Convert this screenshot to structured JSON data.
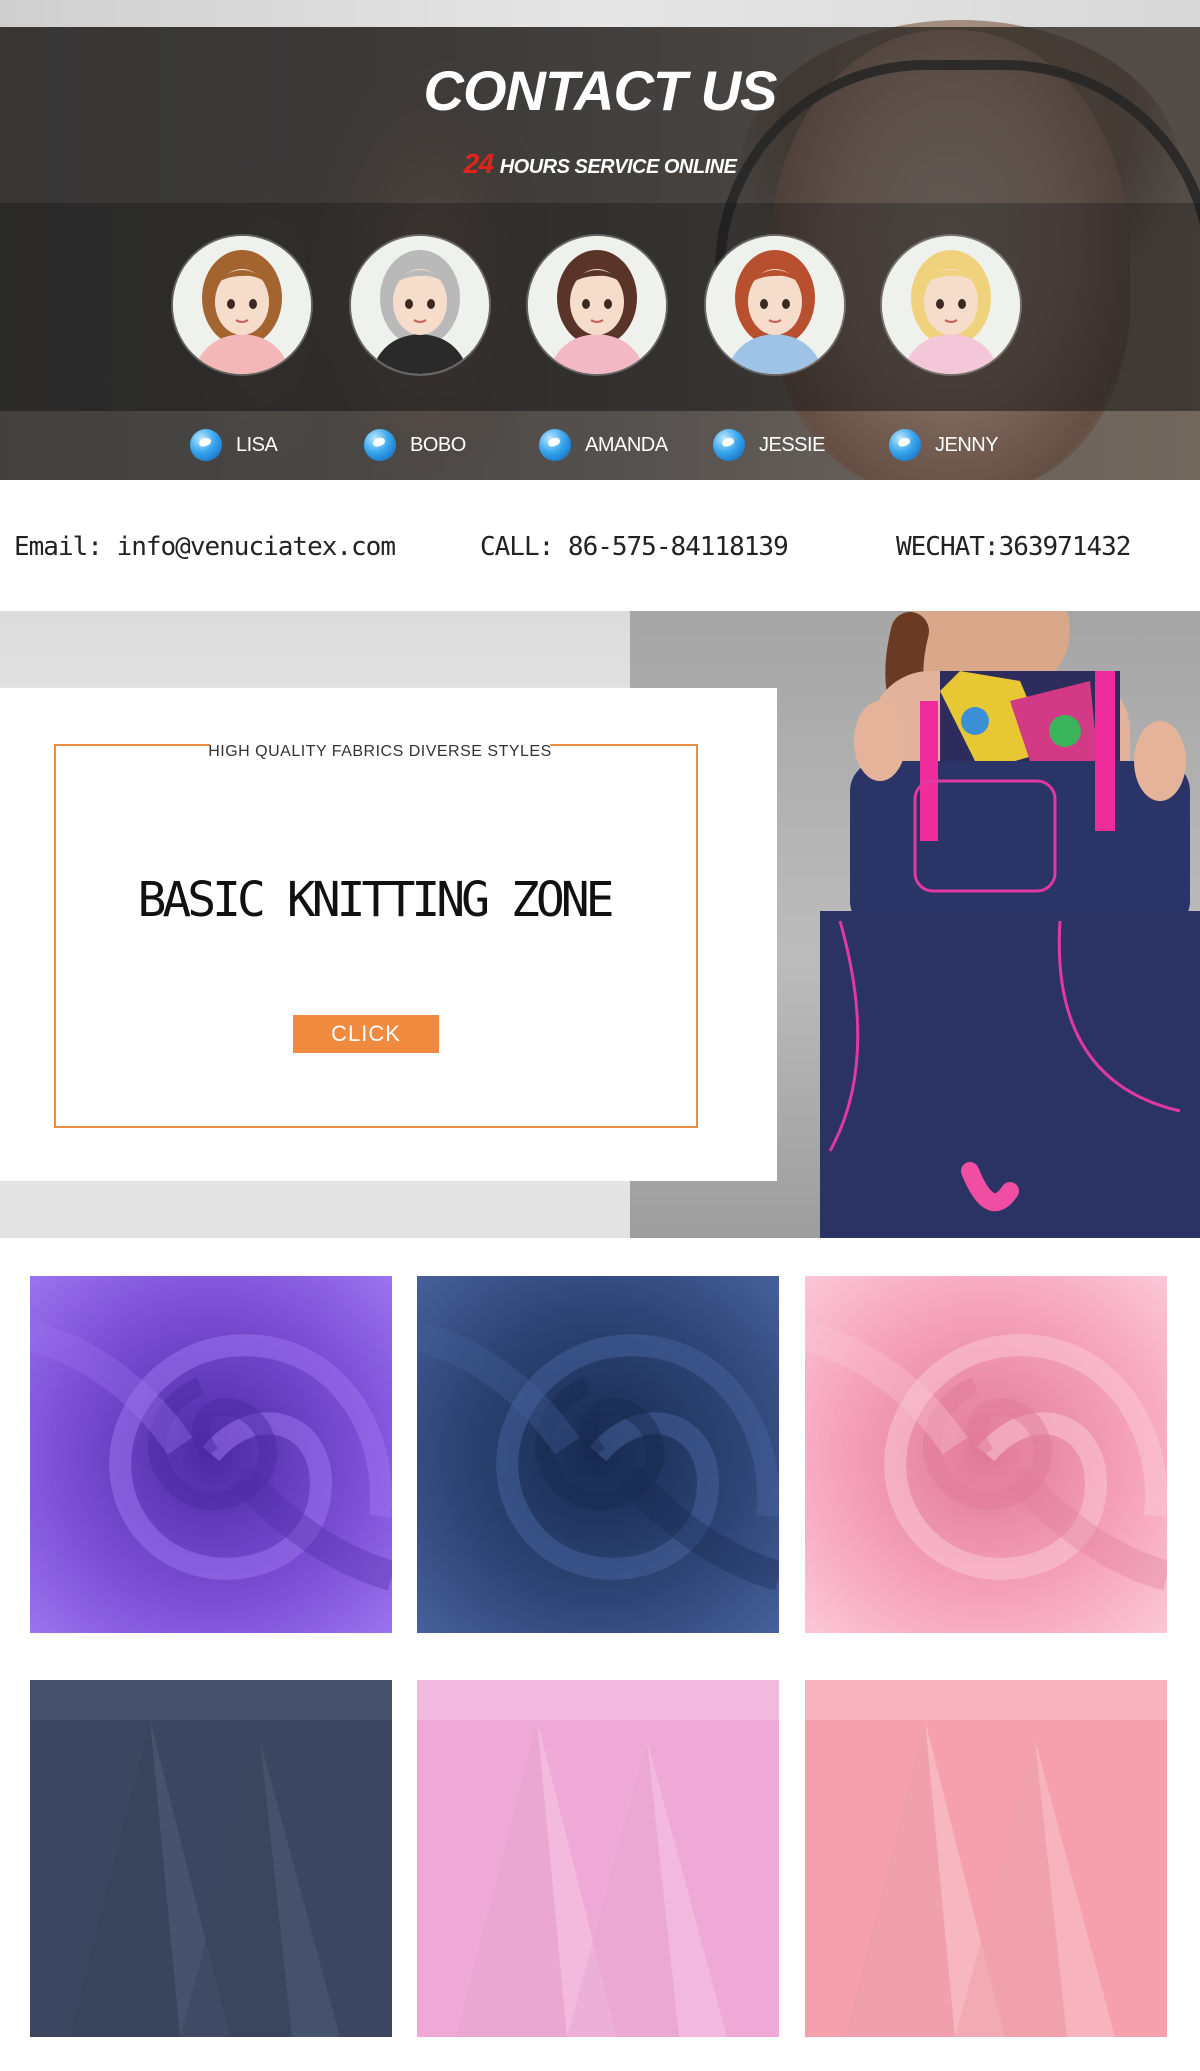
{
  "contact": {
    "title": "CONTACT US",
    "service_number": "24",
    "service_text": "HOURS SERVICE ONLINE",
    "agents": [
      {
        "name": "LISA",
        "hair": "#a3642f",
        "shirt": "#f3b7b7"
      },
      {
        "name": "BOBO",
        "hair": "#b9b9b9",
        "shirt": "#2a2a2a"
      },
      {
        "name": "AMANDA",
        "hair": "#5a3428",
        "shirt": "#f2b9c4"
      },
      {
        "name": "JESSIE",
        "hair": "#b8502f",
        "shirt": "#9fc3e6"
      },
      {
        "name": "JENNY",
        "hair": "#f1d27c",
        "shirt": "#f3c6d8"
      }
    ]
  },
  "info": {
    "email": "Email:  info@venuciatex.com",
    "call": "CALL:  86-575-84118139",
    "wechat": "WECHAT:363971432"
  },
  "banner": {
    "tagline": "HIGH QUALITY FABRICS  DIVERSE STYLES",
    "title": "BASIC KNITTING ZONE",
    "button": "CLICK",
    "accent": "#ef8a3f"
  },
  "gallery": {
    "swatches": [
      {
        "color": "#7b4fd6",
        "dark": "#4c2aa3",
        "light": "#9a73ee",
        "style": "swirl"
      },
      {
        "color": "#2e4677",
        "dark": "#17294f",
        "light": "#46609a",
        "style": "swirl"
      },
      {
        "color": "#f6a3bc",
        "dark": "#e07a98",
        "light": "#fbc7d6",
        "style": "swirl"
      },
      {
        "color": "#3c4660",
        "dark": "#252c40",
        "light": "#566280",
        "style": "fold"
      },
      {
        "color": "#efa9d6",
        "dark": "#d785bd",
        "light": "#f8cfe8",
        "style": "fold"
      },
      {
        "color": "#f5a0ac",
        "dark": "#e37686",
        "light": "#fbd3da",
        "style": "fold"
      }
    ]
  }
}
